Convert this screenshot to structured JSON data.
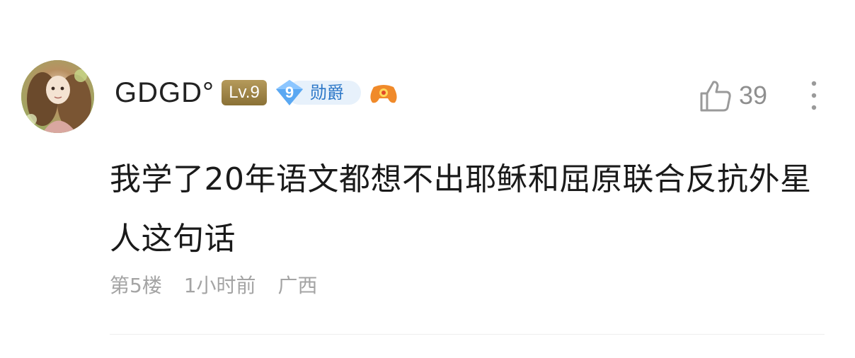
{
  "comment": {
    "username": "GDGD°",
    "level_badge": "Lv.9",
    "honor": {
      "number": "9",
      "title": "勋爵"
    },
    "like_count": "39",
    "content": "我学了20年语文都想不出耶稣和屈原联合反抗外星人这句话",
    "meta": {
      "floor": "第5楼",
      "time": "1小时前",
      "location": "广西"
    }
  },
  "colors": {
    "level_badge": "#8a7136",
    "honor_title": "#2d78c8",
    "meta_text": "#a4a4a4",
    "like_text": "#8f8f8f"
  },
  "icons": [
    "avatar",
    "level-badge",
    "diamond-badge-icon",
    "game-controller-icon",
    "thumbs-up-icon",
    "more-vertical-icon"
  ]
}
